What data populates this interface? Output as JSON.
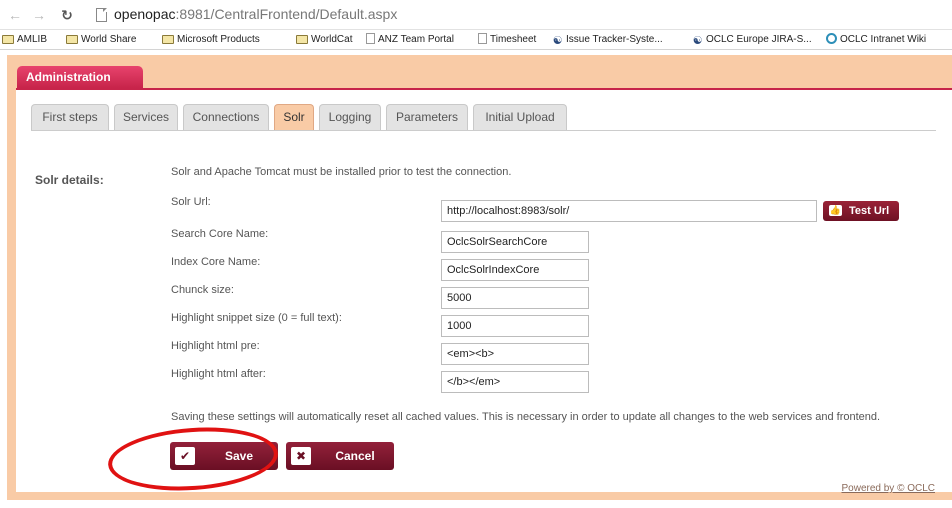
{
  "browser": {
    "url_host": "openopac",
    "url_rest": ":8981/CentralFrontend/Default.aspx",
    "back_icon": "arrow-left-icon",
    "forward_icon": "arrow-right-icon",
    "reload_icon": "reload-icon"
  },
  "bookmarks": [
    {
      "label": "AMLIB",
      "icon": "folder-icon"
    },
    {
      "label": "World Share",
      "icon": "folder-icon"
    },
    {
      "label": "Microsoft Products",
      "icon": "folder-icon"
    },
    {
      "label": "WorldCat",
      "icon": "folder-icon"
    },
    {
      "label": "ANZ Team Portal",
      "icon": "page-icon"
    },
    {
      "label": "Timesheet",
      "icon": "page-icon"
    },
    {
      "label": "Issue Tracker-Syste...",
      "icon": "person-icon"
    },
    {
      "label": "OCLC Europe JIRA-S...",
      "icon": "person-icon"
    },
    {
      "label": "OCLC Intranet Wiki",
      "icon": "swirl-icon"
    }
  ],
  "app": {
    "admin_tab": "Administration",
    "tabs": [
      {
        "label": "First steps",
        "active": false
      },
      {
        "label": "Services",
        "active": false
      },
      {
        "label": "Connections",
        "active": false
      },
      {
        "label": "Solr",
        "active": true
      },
      {
        "label": "Logging",
        "active": false
      },
      {
        "label": "Parameters",
        "active": false
      },
      {
        "label": "Initial Upload",
        "active": false
      }
    ],
    "section_label": "Solr details:",
    "intro": "Solr and Apache Tomcat must be installed prior to test the connection.",
    "fields": [
      {
        "label": "Solr Url:",
        "value": "http://localhost:8983/solr/"
      },
      {
        "label": "Search Core Name:",
        "value": "OclcSolrSearchCore"
      },
      {
        "label": "Index Core Name:",
        "value": "OclcSolrIndexCore"
      },
      {
        "label": "Chunck size:",
        "value": "5000"
      },
      {
        "label": "Highlight snippet size (0 = full text):",
        "value": "1000"
      },
      {
        "label": "Highlight html pre:",
        "value": "<em><b>"
      },
      {
        "label": "Highlight html after:",
        "value": "</b></em>"
      }
    ],
    "test_button": "Test Url",
    "notice": "Saving these settings will automatically reset all cached values. This is necessary in order to update all changes to the web services and frontend.",
    "save_button": "Save",
    "cancel_button": "Cancel",
    "powered_by": "Powered by © OCLC"
  },
  "colors": {
    "accent": "#c7244a",
    "button": "#7a1a2e",
    "frame": "#f9cba6",
    "annotation_circle": "#e01212"
  }
}
